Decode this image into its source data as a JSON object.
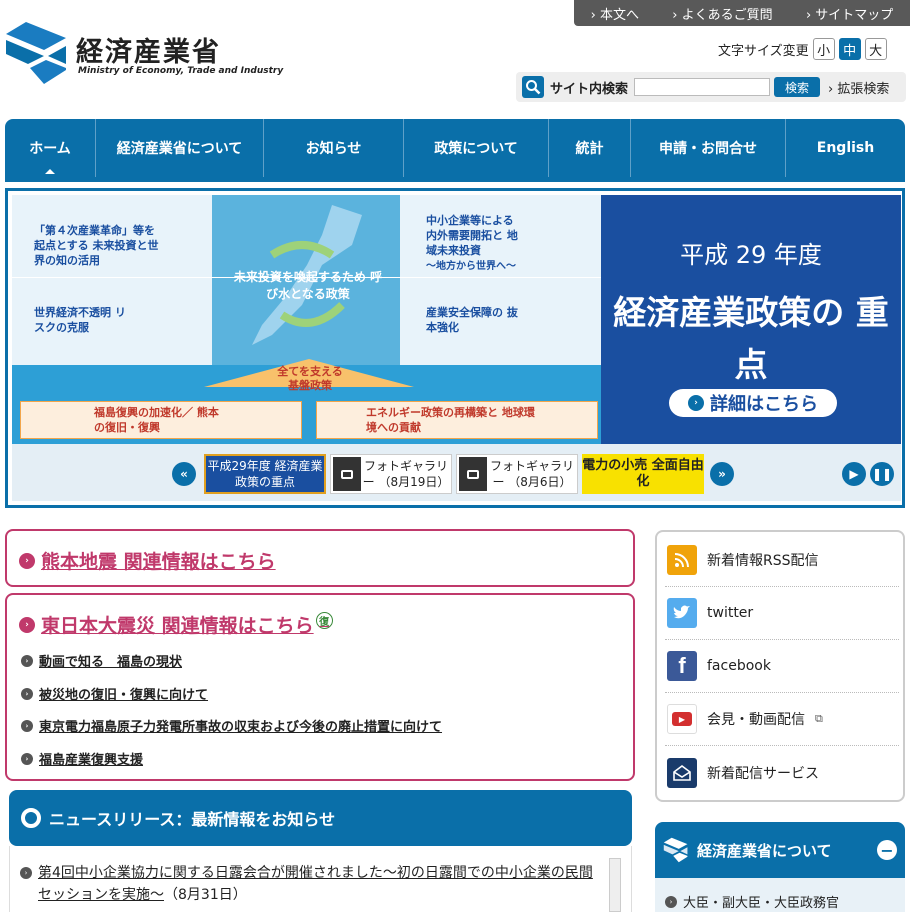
{
  "util_links": [
    "本文へ",
    "よくあるご質問",
    "サイトマップ"
  ],
  "logo": {
    "jp": "経済産業省",
    "en": "Ministry of Economy, Trade and Industry"
  },
  "font_size": {
    "label": "文字サイズ変更",
    "small": "小",
    "medium": "中",
    "large": "大",
    "selected": "中"
  },
  "search": {
    "label": "サイト内検索",
    "value": "",
    "button": "検索",
    "advanced": "拡張検索"
  },
  "nav": [
    "ホーム",
    "経済産業省について",
    "お知らせ",
    "政策について",
    "統計",
    "申請・お問合せ",
    "English"
  ],
  "hero": {
    "cell_1": "「第４次産業革命」等を 起点とする 未来投資と世界の知の活用",
    "cell_2": "中小企業等による 内外需要開拓と 地域未来投資",
    "cell_2b": "〜地方から世界へ〜",
    "cell_center": "未来投資を喚起するため 呼び水となる政策",
    "cell_3": "世界経済不透明 リスクの克服",
    "cell_4": "産業安全保障の 抜本強化",
    "arrow": "全てを支える 基盤政策",
    "cell_5": "福島復興の加速化／ 熊本の復旧・復興",
    "cell_6": "エネルギー政策の再構築と 地球環境への貢献",
    "right_year": "平成 29 年度",
    "right_title": "経済産業政策の 重点",
    "detail_button": "詳細はこちら"
  },
  "thumbs": [
    {
      "text": "平成29年度 経済産業政策の重点"
    },
    {
      "text": "フォトギャラリー （8月19日）"
    },
    {
      "text": "フォトギャラリー （8月6日）"
    },
    {
      "text": "電力の小売 全面自由化"
    }
  ],
  "kumamoto": "熊本地震 関連情報はこちら",
  "higashi": {
    "title": "東日本大震災 関連情報はこちら",
    "badge": "復"
  },
  "higashi_links": [
    "動画で知る　福島の現状",
    "被災地の復旧・復興に向けて",
    "東京電力福島原子力発電所事故の収束および今後の廃止措置に向けて",
    "福島産業復興支援"
  ],
  "news": {
    "title": "ニュースリリース：最新情報をお知らせ",
    "item": "第4回中小企業協力に関する日露会合が開催されました〜初の日露間での中小企業の民間セッションを実施〜",
    "date": "（8月31日）"
  },
  "social": [
    "新着情報RSS配信",
    "twitter",
    "facebook",
    "会見・動画配信",
    "新着配信サービス"
  ],
  "about": {
    "title": "経済産業省について",
    "item": "大臣・副大臣・大臣政務官"
  },
  "colors": {
    "brand": "#0a6fa9",
    "accent": "#c0396b",
    "hero_right": "#1a4fa0"
  }
}
